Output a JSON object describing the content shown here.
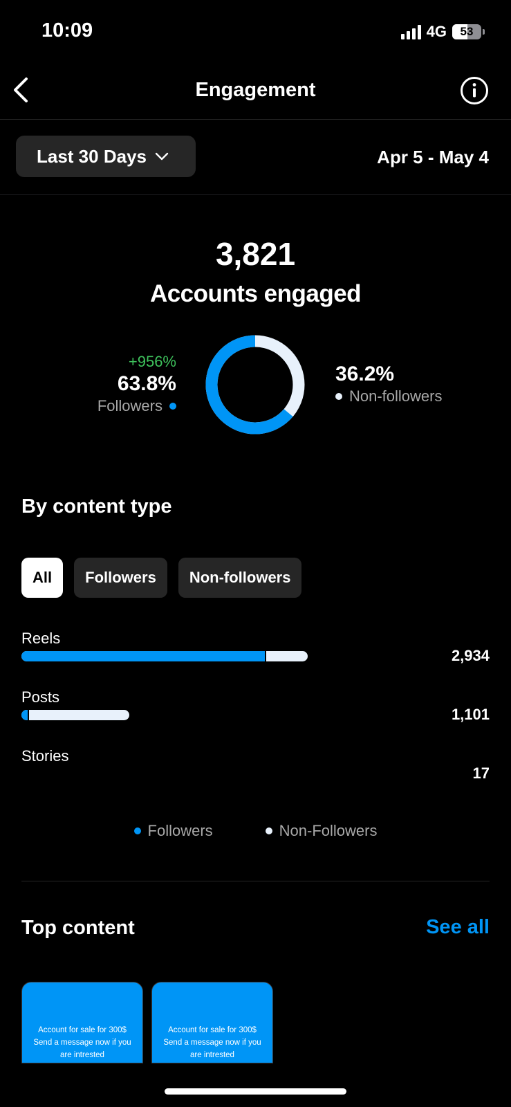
{
  "status_bar": {
    "time": "10:09",
    "network": "4G",
    "battery": "53"
  },
  "header": {
    "title": "Engagement"
  },
  "filter": {
    "range_label": "Last 30 Days",
    "date_range": "Apr 5 - May 4"
  },
  "summary": {
    "total": "3,821",
    "total_label": "Accounts engaged",
    "followers": {
      "growth": "+956%",
      "percent": "63.8%",
      "label": "Followers",
      "fraction": 0.638
    },
    "non_followers": {
      "percent": "36.2%",
      "label": "Non-followers",
      "fraction": 0.362
    }
  },
  "content_type": {
    "title": "By content type",
    "tabs": [
      "All",
      "Followers",
      "Non-followers"
    ],
    "active_tab": "All",
    "rows": [
      {
        "label": "Reels",
        "value": "2,934",
        "followers_share": 0.856
      },
      {
        "label": "Posts",
        "value": "1,101",
        "followers_share": 0.07
      },
      {
        "label": "Stories",
        "value": "17",
        "followers_share": 0
      }
    ],
    "legend": {
      "followers": "Followers",
      "non_followers": "Non-Followers"
    }
  },
  "top_content": {
    "title": "Top content",
    "see_all": "See all",
    "items": [
      {
        "text": "Account for sale for 300$ Send a message now if you are intrested"
      },
      {
        "text": "Account for sale for 300$ Send a message now if you are intrested"
      }
    ]
  },
  "colors": {
    "accent": "#0095f6",
    "non_followers": "#e8f1fb",
    "growth": "#3ec25c"
  }
}
